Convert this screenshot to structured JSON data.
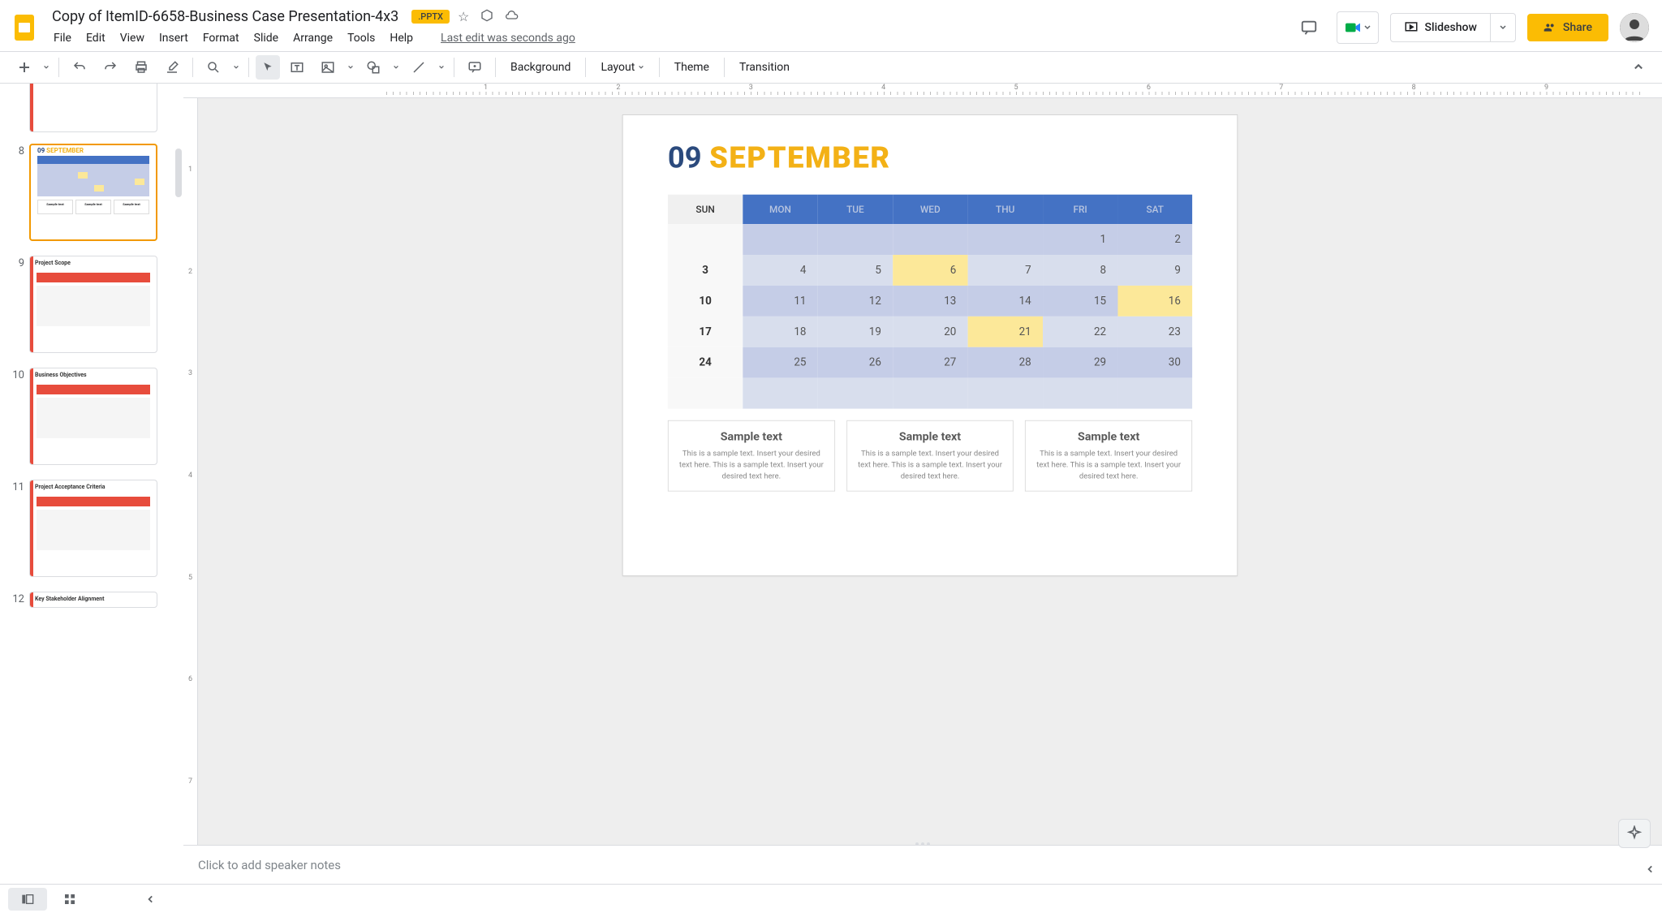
{
  "header": {
    "title": "Copy of ItemID-6658-Business Case Presentation-4x3",
    "badge": ".PPTX",
    "last_edit": "Last edit was seconds ago"
  },
  "menus": [
    "File",
    "Edit",
    "View",
    "Insert",
    "Format",
    "Slide",
    "Arrange",
    "Tools",
    "Help"
  ],
  "toolbar_text": {
    "background": "Background",
    "layout": "Layout",
    "theme": "Theme",
    "transition": "Transition"
  },
  "actions": {
    "slideshow": "Slideshow",
    "share": "Share"
  },
  "ruler_h": [
    "",
    "1",
    "",
    "2",
    "",
    "3",
    "",
    "4",
    "",
    "5",
    "",
    "6",
    "",
    "7",
    "",
    "8",
    "",
    "9",
    ""
  ],
  "ruler_v": [
    "",
    "1",
    "",
    "2",
    "",
    "3",
    "",
    "4",
    "",
    "5",
    "",
    "6",
    "",
    "7"
  ],
  "filmstrip": [
    {
      "num": "",
      "type": "partial-top"
    },
    {
      "num": "8",
      "type": "calendar",
      "selected": true
    },
    {
      "num": "9",
      "type": "scope",
      "title": "Project Scope"
    },
    {
      "num": "10",
      "type": "objectives",
      "title": "Business Objectives"
    },
    {
      "num": "11",
      "type": "criteria",
      "title": "Project Acceptance Criteria"
    },
    {
      "num": "12",
      "type": "partial-bottom",
      "title": "Key Stakeholder Alignment"
    }
  ],
  "slide": {
    "num": "09",
    "month": "SEPTEMBER",
    "days": [
      "SUN",
      "MON",
      "TUE",
      "WED",
      "THU",
      "FRI",
      "SAT"
    ],
    "rows": [
      {
        "sun": "",
        "cells": [
          {
            "v": ""
          },
          {
            "v": ""
          },
          {
            "v": ""
          },
          {
            "v": ""
          },
          {
            "v": "1"
          },
          {
            "v": "2"
          }
        ],
        "alt": false
      },
      {
        "sun": "3",
        "cells": [
          {
            "v": "4"
          },
          {
            "v": "5"
          },
          {
            "v": "6",
            "hl": true
          },
          {
            "v": "7"
          },
          {
            "v": "8"
          },
          {
            "v": "9"
          }
        ],
        "alt": true
      },
      {
        "sun": "10",
        "cells": [
          {
            "v": "11"
          },
          {
            "v": "12"
          },
          {
            "v": "13"
          },
          {
            "v": "14"
          },
          {
            "v": "15"
          },
          {
            "v": "16",
            "hl": true
          }
        ],
        "alt": false
      },
      {
        "sun": "17",
        "cells": [
          {
            "v": "18"
          },
          {
            "v": "19"
          },
          {
            "v": "20"
          },
          {
            "v": "21",
            "hl": true
          },
          {
            "v": "22"
          },
          {
            "v": "23"
          }
        ],
        "alt": true
      },
      {
        "sun": "24",
        "cells": [
          {
            "v": "25"
          },
          {
            "v": "26"
          },
          {
            "v": "27"
          },
          {
            "v": "28"
          },
          {
            "v": "29"
          },
          {
            "v": "30"
          }
        ],
        "alt": false
      },
      {
        "sun": "",
        "cells": [
          {
            "v": ""
          },
          {
            "v": ""
          },
          {
            "v": ""
          },
          {
            "v": ""
          },
          {
            "v": ""
          },
          {
            "v": ""
          }
        ],
        "alt": true
      }
    ],
    "sample_boxes": [
      {
        "title": "Sample text",
        "body": "This is a sample text. Insert your desired text here. This is a sample text. Insert your desired text here."
      },
      {
        "title": "Sample text",
        "body": "This is a sample text. Insert your desired text here. This is a sample text. Insert your desired text here."
      },
      {
        "title": "Sample text",
        "body": "This is a sample text. Insert your desired text here. This is a sample text. Insert your desired text here."
      }
    ]
  },
  "notes": {
    "placeholder": "Click to add speaker notes"
  }
}
